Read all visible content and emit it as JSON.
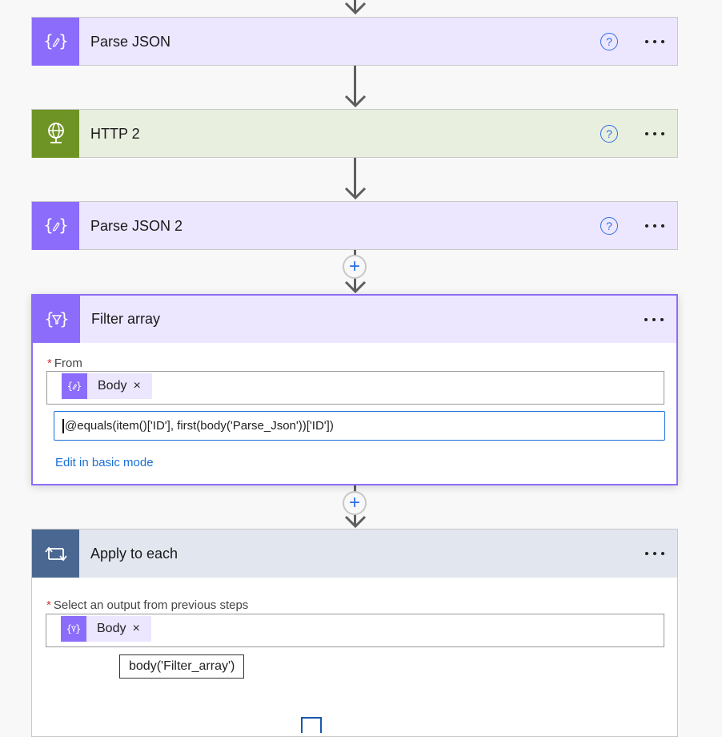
{
  "cards": {
    "parse_json": {
      "title": "Parse JSON",
      "help": "?",
      "color_icon": "#8c6cfa",
      "color_head": "#ece6ff"
    },
    "http2": {
      "title": "HTTP 2",
      "help": "?",
      "color_icon": "#6f9426",
      "color_head": "#e9efdf"
    },
    "parse_json2": {
      "title": "Parse JSON 2",
      "help": "?",
      "color_icon": "#8c6cfa",
      "color_head": "#ece6ff"
    },
    "filter_array": {
      "title": "Filter array",
      "from_label": "From",
      "from_token": "Body",
      "expression": "@equals(item()['ID'], first(body('Parse_Json'))['ID'])",
      "edit_mode_link": "Edit in basic mode",
      "color_border": "#8c6cfa"
    },
    "apply_to_each": {
      "title": "Apply to each",
      "select_label": "Select an output from previous steps",
      "select_token": "Body",
      "tooltip": "body('Filter_array')",
      "color_icon": "#4a6791",
      "color_head": "#e2e7ef"
    }
  },
  "common": {
    "required_mark": "*",
    "remove_token": "×",
    "add_step": "+"
  }
}
